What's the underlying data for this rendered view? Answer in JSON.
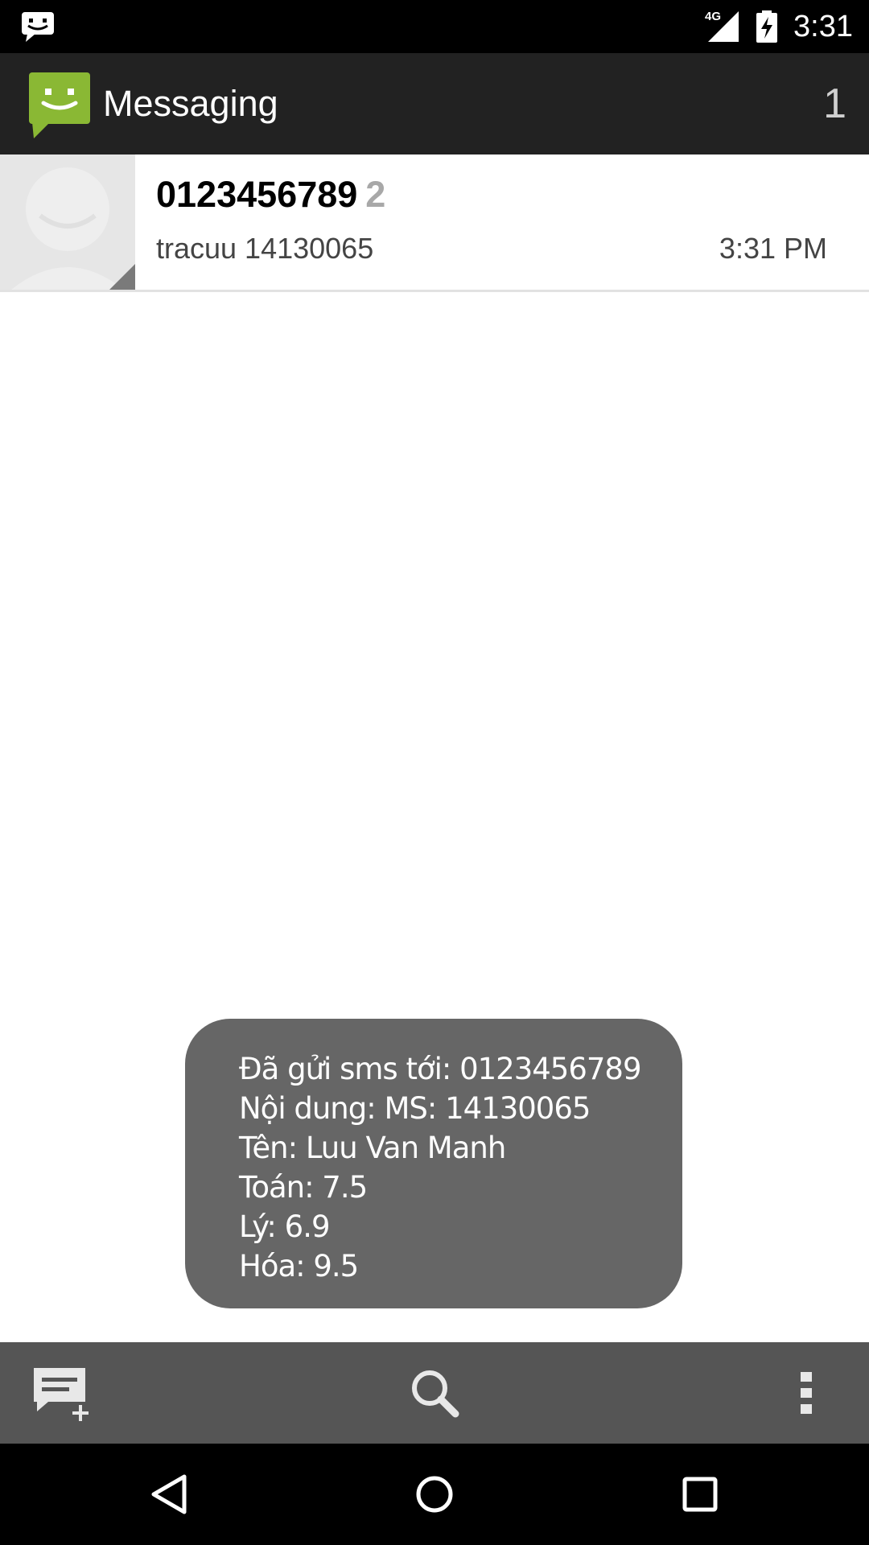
{
  "status_bar": {
    "network_type": "4G",
    "time": "3:31",
    "icons": [
      "message-notification-icon",
      "signal-icon",
      "battery-charging-icon"
    ]
  },
  "action_bar": {
    "title": "Messaging",
    "unread_count": "1",
    "app_icon": "messaging-app-icon",
    "accent_color": "#8ab834"
  },
  "conversations": [
    {
      "name": "0123456789",
      "count": "2",
      "snippet": "tracuu 14130065",
      "time": "3:31 PM"
    }
  ],
  "toast": {
    "lines": [
      "Đã gửi sms tới: 0123456789",
      "Nội dung: MS: 14130065",
      "Tên: Luu Van Manh",
      "Toán: 7.5",
      "Lý: 6.9",
      "Hóa: 9.5"
    ]
  },
  "bottom_bar": {
    "icons": [
      "new-message-icon",
      "search-icon",
      "overflow-menu-icon"
    ]
  },
  "nav_bar": {
    "icons": [
      "back-icon",
      "home-icon",
      "recents-icon"
    ]
  }
}
